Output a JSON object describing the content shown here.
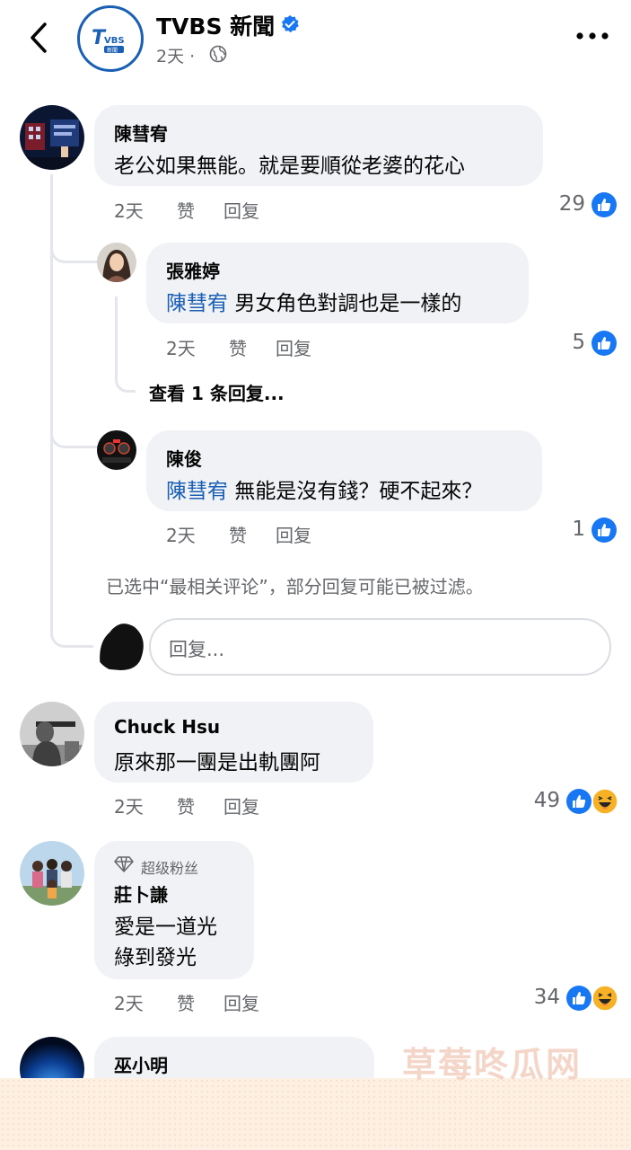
{
  "header": {
    "page_name": "TVBS 新聞",
    "logo_text": "TVBS",
    "logo_subtext": "新聞",
    "time": "2天",
    "separator": "·",
    "back_icon": "chevron-left-icon",
    "more_icon": "more-dots-icon"
  },
  "comments": [
    {
      "author": "陳彗宥",
      "text": "老公如果無能。就是要順從老婆的花心",
      "time": "2天",
      "like_label": "赞",
      "reply_label": "回复",
      "reactions": "29",
      "reaction_icons": [
        "like-icon"
      ],
      "replies": [
        {
          "author": "張雅婷",
          "mention": "陳彗宥",
          "text": "男女角色對調也是一樣的",
          "time": "2天",
          "like_label": "赞",
          "reply_label": "回复",
          "reactions": "5",
          "view_more": "查看 1 条回复..."
        },
        {
          "author": "陳俊",
          "mention": "陳彗宥",
          "text": "無能是沒有錢？硬不起來？",
          "time": "2天",
          "like_label": "赞",
          "reply_label": "回复",
          "reactions": "1"
        }
      ],
      "filter_note": "已选中“最相关评论”，部分回复可能已被过滤。",
      "reply_placeholder": "回复..."
    },
    {
      "author": "Chuck Hsu",
      "text": "原來那一團是出軌團阿",
      "time": "2天",
      "like_label": "赞",
      "reply_label": "回复",
      "reactions": "49",
      "reaction_icons": [
        "like-icon",
        "haha-icon"
      ]
    },
    {
      "badge": "超级粉丝",
      "author": "莊卜謙",
      "text_line1": "愛是一道光",
      "text_line2": "綠到發光",
      "time": "2天",
      "like_label": "赞",
      "reply_label": "回复",
      "reactions": "34",
      "reaction_icons": [
        "like-icon",
        "haha-icon"
      ]
    },
    {
      "author": "巫小明"
    }
  ],
  "watermark": "草莓咚瓜网",
  "colors": {
    "accent": "#1877f2",
    "mention": "#1a5fb4",
    "bubble": "#f0f2f5",
    "muted": "#65676b"
  }
}
